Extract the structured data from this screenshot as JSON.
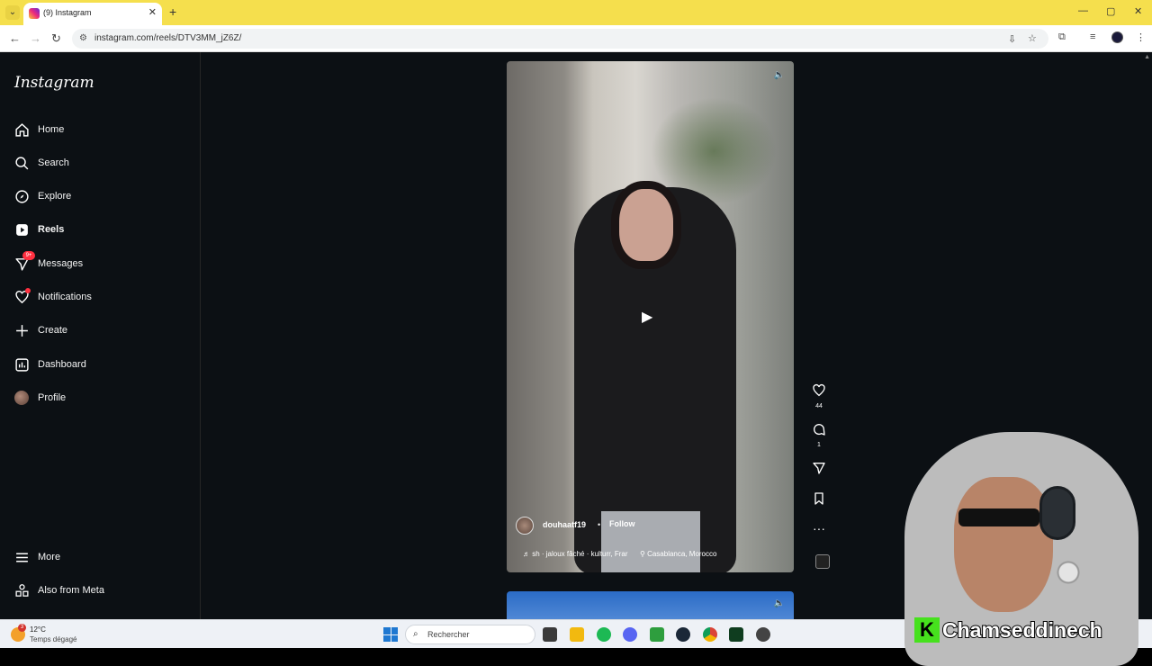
{
  "browser": {
    "tab_title": "(9) Instagram",
    "tab_close": "✕",
    "new_tab": "+",
    "url": "instagram.com/reels/DTV3MM_jZ6Z/",
    "window_controls": {
      "minimize": "—",
      "maximize": "▢",
      "close": "✕"
    }
  },
  "instagram": {
    "logo": "Instagram",
    "nav": [
      {
        "label": "Home",
        "icon": "home-icon"
      },
      {
        "label": "Search",
        "icon": "search-icon"
      },
      {
        "label": "Explore",
        "icon": "compass-icon"
      },
      {
        "label": "Reels",
        "icon": "reels-icon"
      },
      {
        "label": "Messages",
        "icon": "messenger-icon",
        "badge": "9+"
      },
      {
        "label": "Notifications",
        "icon": "heart-icon"
      },
      {
        "label": "Create",
        "icon": "plus-icon"
      },
      {
        "label": "Dashboard",
        "icon": "dashboard-icon"
      },
      {
        "label": "Profile",
        "icon": "avatar"
      }
    ],
    "more": "More",
    "also_from_meta": "Also from Meta",
    "reel": {
      "username": "douhaatf19",
      "separator": "•",
      "follow": "Follow",
      "audio": "♬ sh · jaloux fâché · kulturr, Frar",
      "location": "⚲ Casablanca, Morocco",
      "likes": "44",
      "comments": "1"
    }
  },
  "taskbar": {
    "weather_badge": "3",
    "temperature": "12°C",
    "weather": "Temps dégagé",
    "search_placeholder": "Rechercher"
  },
  "webcam": {
    "name_initial": "K",
    "name": "Chamseddinech"
  },
  "colors": {
    "tabbar": "#f5df4d",
    "ig_background": "#0c1014",
    "badge": "#ff3040",
    "overlay_green": "#46e11d"
  }
}
